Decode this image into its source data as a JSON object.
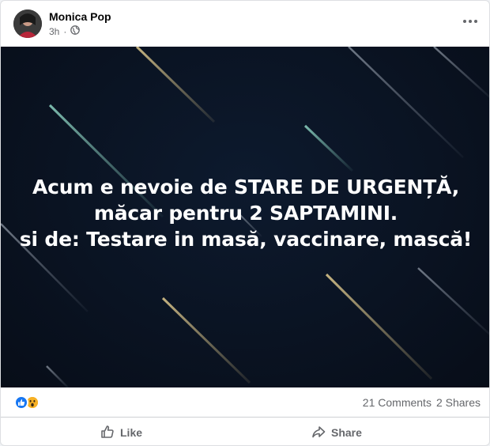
{
  "post": {
    "author": "Monica Pop",
    "time": "3h",
    "privacy_icon": "globe-icon",
    "more_icon": "more-options-icon",
    "image_text": {
      "line1": "Acum e nevoie de STARE DE URGENȚĂ,",
      "line2": "măcar pentru 2 SAPTAMINI.",
      "line3": "si de: Testare in masă, vaccinare, mască!"
    }
  },
  "stats": {
    "reactions": [
      "like",
      "wow"
    ],
    "comments": "21 Comments",
    "shares": "2 Shares"
  },
  "actions": {
    "like_label": "Like",
    "share_label": "Share"
  },
  "colors": {
    "like_blue": "#1877f2",
    "wow_yellow": "#f7b125",
    "meta_gray": "#65676b",
    "image_bg": "#0a1322"
  }
}
